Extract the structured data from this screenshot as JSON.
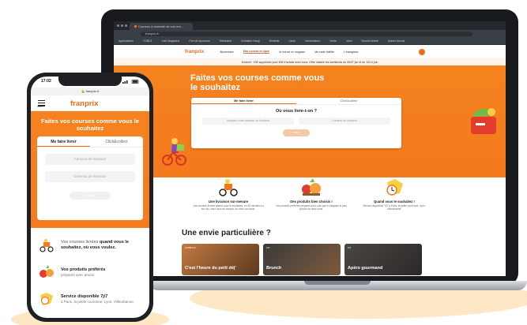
{
  "browser": {
    "tab_title": "Courses à domicile de vos ma...",
    "url": "franprix.fr",
    "bookmarks": [
      "Applications",
      "TGBU1",
      "Voix Magazine",
      "Fort de sponsors",
      "Webinaire",
      "Invitation Hang",
      "Dentelle",
      "Lacie",
      "Informations",
      "Vente",
      "Voici",
      "Nouvel Article",
      "Autres favoris"
    ]
  },
  "desktop": {
    "logo": "franprix",
    "nav": [
      "Alimentaire",
      "Mes courses en ligne",
      "Je trouve un magasin",
      "Ma carte fidélité",
      "L'Instaglace"
    ],
    "nav_active_index": 1,
    "banner": "Exclusif : 10€ supprimés pour 60€ d'achats avec bons. Offre valable les weekends du 06/07 jun et du 13/14 juin",
    "hero_title": "Faites vos courses comme vous le souhaitez",
    "tab_delivery": "Me faire livrer",
    "tab_click": "Click&collect",
    "question": "Où vous livre-t-on ?",
    "address_placeholder": "Indiquez votre adresse de livraison",
    "slot_placeholder": "Créneau de livraison",
    "submit": "Valider",
    "features": [
      {
        "title": "Une livraison sur-mesure",
        "desc": "Vos courses livrées quand vous le souhaitez, en 30 minutes ou sur rdv, chez vous au bureau, ou chez vos amis."
      },
      {
        "title": "Des produits bien choisis !",
        "desc": "Vos produits préférés préparés avec soin par le magasin le plus proche de chez vous."
      },
      {
        "title": "Quand vous le souhaitez !",
        "desc": "Service disponible 7j/7 à Paris, la petite couronne, Lyon, Villeurbanne."
      }
    ],
    "envie_title": "Une envie particulière ?",
    "cards": [
      {
        "kicker": "FORMULE",
        "label": "C'est l'heure du petit déj'"
      },
      {
        "kicker": "KIT",
        "label": "Brunch"
      },
      {
        "kicker": "KIT",
        "label": "Apéro gourmand"
      }
    ]
  },
  "mobile": {
    "time": "17:02",
    "url": "franprix.fr",
    "menu_label": "Menu",
    "logo": "franprix",
    "hero_title": "Faites vos courses comme vous le souhaitez",
    "tab_delivery": "Me faire livrer",
    "tab_click": "Click&collect",
    "address_placeholder": "Adresse de livraison",
    "slot_placeholder": "Créneau de livraison",
    "submit": "Valider",
    "features": [
      {
        "pre": "Vos courses livrées",
        "bold": "quand vous le souhaitez, où vous voulez.",
        "desc": ""
      },
      {
        "pre": "",
        "bold": "Vos produits préférés",
        "desc": "préparés avec amour"
      },
      {
        "pre": "",
        "bold": "Service disponible 7j/7",
        "desc": "à Paris, la petite couronne, Lyon, Villeurbanne."
      }
    ]
  },
  "colors": {
    "brand_orange": "#f37a1e",
    "bezel": "#17191d"
  }
}
